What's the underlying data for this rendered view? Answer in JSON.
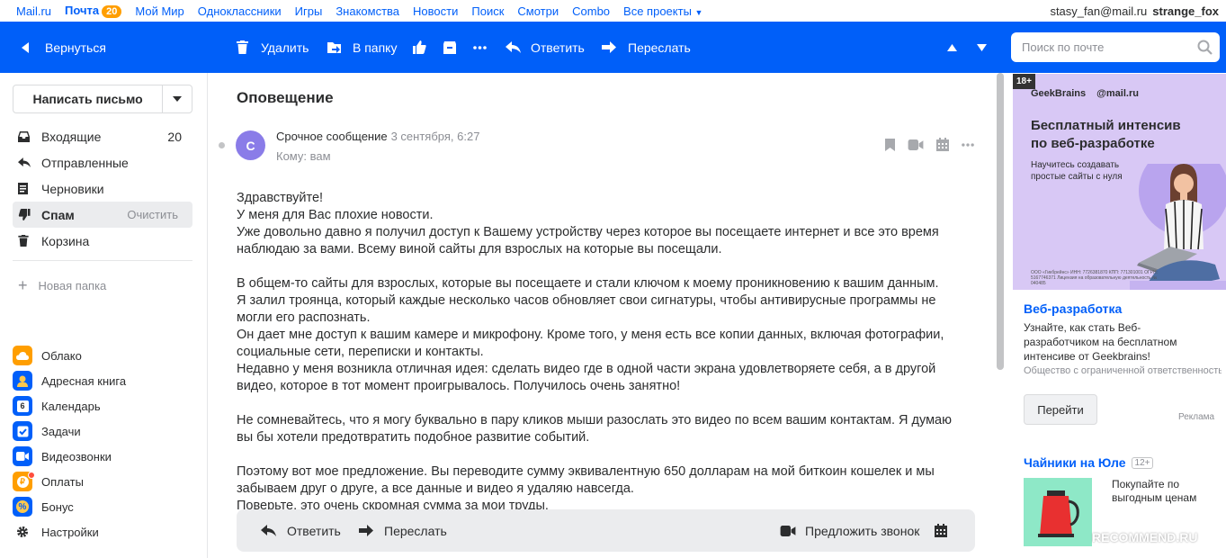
{
  "portal": {
    "links": [
      "Mail.ru",
      "Почта",
      "Мой Мир",
      "Одноклассники",
      "Игры",
      "Знакомства",
      "Новости",
      "Поиск",
      "Смотри",
      "Combo",
      "Все проекты"
    ],
    "mail_badge": "20",
    "email": "stasy_fan@mail.ru",
    "username": "strange_fox"
  },
  "toolbar": {
    "back": "Вернуться",
    "delete": "Удалить",
    "to_folder": "В папку",
    "reply": "Ответить",
    "forward": "Переслать",
    "search_placeholder": "Поиск по почте"
  },
  "sidebar": {
    "compose": "Написать письмо",
    "folders": [
      {
        "label": "Входящие",
        "count": "20",
        "icon": "inbox-icon"
      },
      {
        "label": "Отправленные",
        "count": "",
        "icon": "sent-icon"
      },
      {
        "label": "Черновики",
        "count": "",
        "icon": "drafts-icon"
      },
      {
        "label": "Спам",
        "count": "",
        "icon": "spam-icon",
        "action": "Очистить"
      },
      {
        "label": "Корзина",
        "count": "",
        "icon": "trash-icon"
      }
    ],
    "new_folder": "Новая папка",
    "apps": [
      {
        "label": "Облако",
        "color": "#ff9e00",
        "icon": "cloud-icon"
      },
      {
        "label": "Адресная книга",
        "color": "#005ff9",
        "icon": "contacts-icon"
      },
      {
        "label": "Календарь",
        "color": "#005ff9",
        "icon": "calendar-icon",
        "glyph": "6"
      },
      {
        "label": "Задачи",
        "color": "#005ff9",
        "icon": "tasks-icon"
      },
      {
        "label": "Видеозвонки",
        "color": "#005ff9",
        "icon": "video-icon"
      },
      {
        "label": "Оплаты",
        "color": "#ff9e00",
        "icon": "payments-icon"
      },
      {
        "label": "Бонус",
        "color": "#005ff9",
        "icon": "bonus-icon",
        "glyph": "%"
      },
      {
        "label": "Настройки",
        "color": "",
        "icon": "gear-icon"
      }
    ]
  },
  "message": {
    "subject": "Оповещение",
    "avatar_letter": "С",
    "sender": "Срочное сообщение",
    "date": "3 сентября, 6:27",
    "to": "Кому: вам",
    "paragraphs": [
      [
        "Здравствуйте!",
        "У меня для Вас плохие новости.",
        "Уже довольно давно я получил доступ к Вашему устройству через которое вы посещаете интернет и все это время",
        "наблюдаю за вами. Всему виной сайты для взрослых на которые вы посещали."
      ],
      [
        "В общем-то сайты для взрослых, которые вы посещаете и стали ключом к моему проникновению к вашим данным.",
        "Я залил троянца, который каждые несколько часов обновляет свои сигнатуры, чтобы антивирусные программы не",
        "могли его распознать.",
        "Он дает мне доступ к вашим камере и микрофону. Кроме того, у меня есть все копии данных, включая фотографии,",
        "социальные сети, переписки и контакты.",
        "Недавно у меня возникла отличная идея: сделать видео где в одной части экрана удовлетворяете себя, а в другой",
        "видео, которое в тот момент проигрывалось. Получилось очень занятно!"
      ],
      [
        "Не сомневайтесь, что я могу буквально в пару кликов мыши разослать это видео по всем вашим контактам. Я думаю",
        "вы бы хотели предотвратить подобное развитие событий."
      ],
      [
        "Поэтому вот мое предложение. Вы переводите сумму эквивалентную 650 долларам на мой биткоин кошелек и мы",
        "забываем друг о друге, а все данные и видео я удаляю навсегда.",
        "Поверьте, это очень скромная сумма за мои труды."
      ]
    ]
  },
  "replybar": {
    "reply": "Ответить",
    "forward": "Переслать",
    "call": "Предложить звонок"
  },
  "ads": {
    "age_tag": "18+",
    "banner_logo1": "GeekBrains",
    "banner_logo2": "@mail.ru",
    "banner_title": "Бесплатный интенсив по веб-разработке",
    "banner_sub": "Научитесь создавать простые сайты с нуля",
    "banner_legal": "ООО «Гикбрейнс» ИНН: 7726381870 КПП: 771301001 ОГРН: 5167746371 Лицензия на образовательную деятельность № 040485",
    "ad1_title": "Веб-разработка",
    "ad1_text": "Узнайте, как стать Веб-разработчиком на бесплатном интенсиве от Geekbrains!",
    "ad1_org": "Общество с ограниченной ответственностью",
    "ad1_button": "Перейти",
    "ad_mark": "Реклама",
    "ad2_title": "Чайники на Юле",
    "ad2_age": "12+",
    "ad2_text": "Покупайте по выгодным ценам"
  },
  "watermark": "RECOMMEND.RU"
}
